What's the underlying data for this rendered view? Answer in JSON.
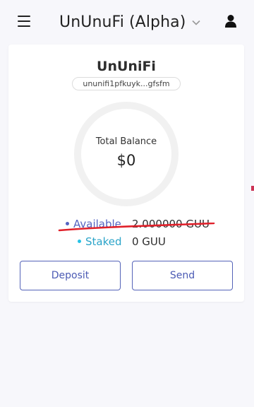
{
  "header": {
    "title": "UnUnuFi (Alpha)",
    "menu_icon": "hamburger-menu-icon",
    "dropdown_icon": "chevron-down-icon",
    "user_icon": "user-icon"
  },
  "wallet": {
    "name": "UnUniFi",
    "address_short": "ununifi1pfkuyk...gfsfm",
    "total_balance_label": "Total Balance",
    "total_balance_value": "$0"
  },
  "balances": {
    "available_label": "Available",
    "available_value": "2.000000 GUU",
    "staked_label": "Staked",
    "staked_value": "0 GUU"
  },
  "actions": {
    "deposit_label": "Deposit",
    "send_label": "Send"
  },
  "colors": {
    "accent": "#5463b8",
    "available_dot": "#5563c1",
    "staked_dot": "#26c2e6",
    "annotation_underline": "#e0202a"
  }
}
